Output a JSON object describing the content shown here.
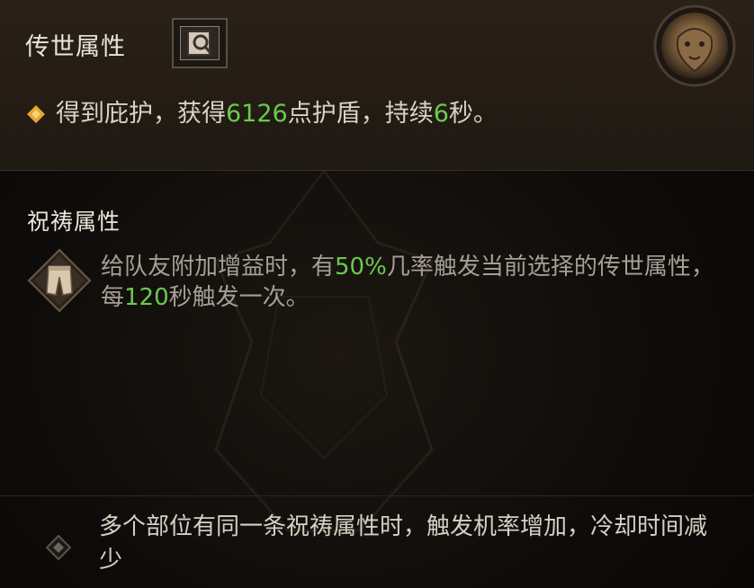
{
  "legendary": {
    "title": "传世属性",
    "effect": {
      "prefix": "得到庇护，获得",
      "shield_value": "6126",
      "middle": "点护盾，持续",
      "duration": "6",
      "suffix": "秒。"
    }
  },
  "prayer": {
    "title": "祝祷属性",
    "desc": {
      "part1": "给队友附加增益时，有",
      "chance": "50%",
      "part2": "几率触发当前选择的传世属性，每",
      "cooldown": "120",
      "part3": "秒触发一次。"
    }
  },
  "note": {
    "text": "多个部位有同一条祝祷属性时，触发机率增加，冷却时间减少"
  },
  "icons": {
    "codex": "codex-icon",
    "emblem": "lion-head-emblem-icon",
    "effect_bullet": "gold-diamond-icon",
    "item": "pants-icon",
    "note_bullet": "grey-diamond-icon"
  },
  "colors": {
    "highlight": "#6cc94e",
    "bullet_gold": "#e7a534"
  }
}
